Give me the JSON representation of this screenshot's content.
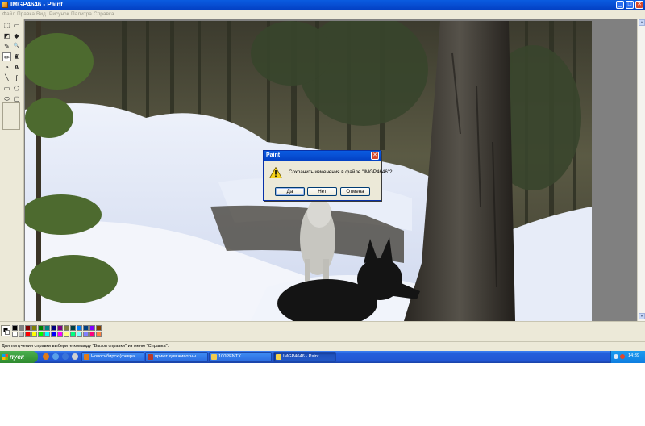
{
  "window": {
    "title": "IMGP4646 - Paint",
    "buttons": {
      "minimize": "_",
      "maximize": "□",
      "close": "✕"
    }
  },
  "menu": [
    {
      "label": "Файл"
    },
    {
      "label": "Правка"
    },
    {
      "label": "Вид"
    },
    {
      "label": "Рисунок"
    },
    {
      "label": "Палитра"
    },
    {
      "label": "Справка"
    }
  ],
  "toolbox": {
    "tools": [
      {
        "name": "free-select-icon",
        "glyph": "⬚"
      },
      {
        "name": "rect-select-icon",
        "glyph": "▭"
      },
      {
        "name": "eraser-icon",
        "glyph": "◩"
      },
      {
        "name": "fill-icon",
        "glyph": "◆"
      },
      {
        "name": "color-picker-icon",
        "glyph": "✎"
      },
      {
        "name": "magnifier-icon",
        "glyph": "🔍"
      },
      {
        "name": "pencil-icon",
        "glyph": "✏"
      },
      {
        "name": "brush-icon",
        "glyph": "♜"
      },
      {
        "name": "airbrush-icon",
        "glyph": "◔"
      },
      {
        "name": "text-icon",
        "glyph": "A"
      },
      {
        "name": "line-icon",
        "glyph": "╲"
      },
      {
        "name": "curve-icon",
        "glyph": "∫"
      },
      {
        "name": "rectangle-icon",
        "glyph": "▭"
      },
      {
        "name": "polygon-icon",
        "glyph": "⬠"
      },
      {
        "name": "ellipse-icon",
        "glyph": "⬭"
      },
      {
        "name": "rounded-rect-icon",
        "glyph": "▢"
      }
    ]
  },
  "dialog": {
    "title": "Paint",
    "message": "Сохранить изменения в файле \"IMGP4646\"?",
    "icon": "warning-icon",
    "buttons": {
      "yes": "Да",
      "no": "Нет",
      "cancel": "Отмена"
    }
  },
  "palette": {
    "top": [
      "#000000",
      "#808080",
      "#800000",
      "#808000",
      "#008000",
      "#008080",
      "#000080",
      "#800080",
      "#808040",
      "#004040",
      "#0080ff",
      "#004080",
      "#8000ff",
      "#804000"
    ],
    "bottom": [
      "#ffffff",
      "#c0c0c0",
      "#ff0000",
      "#ffff00",
      "#00ff00",
      "#00ffff",
      "#0000ff",
      "#ff00ff",
      "#ffff80",
      "#00ff80",
      "#80ffff",
      "#8080ff",
      "#ff0080",
      "#ff8040"
    ]
  },
  "status": {
    "text": "Для получения справки выберите команду \"Вызов справки\" из меню \"Справка\"."
  },
  "taskbar": {
    "start": "пуск",
    "tasks": [
      {
        "label": "Новосибирск (февра...",
        "icon_color": "#e07b1a"
      },
      {
        "label": "приют для животны...",
        "icon_color": "#b83a2a"
      },
      {
        "label": "100PENTX",
        "icon_color": "#f0cc50"
      },
      {
        "label": "IMGP4646 - Paint",
        "icon_color": "#f5d34b",
        "active": true
      }
    ],
    "clock": "14:39"
  }
}
